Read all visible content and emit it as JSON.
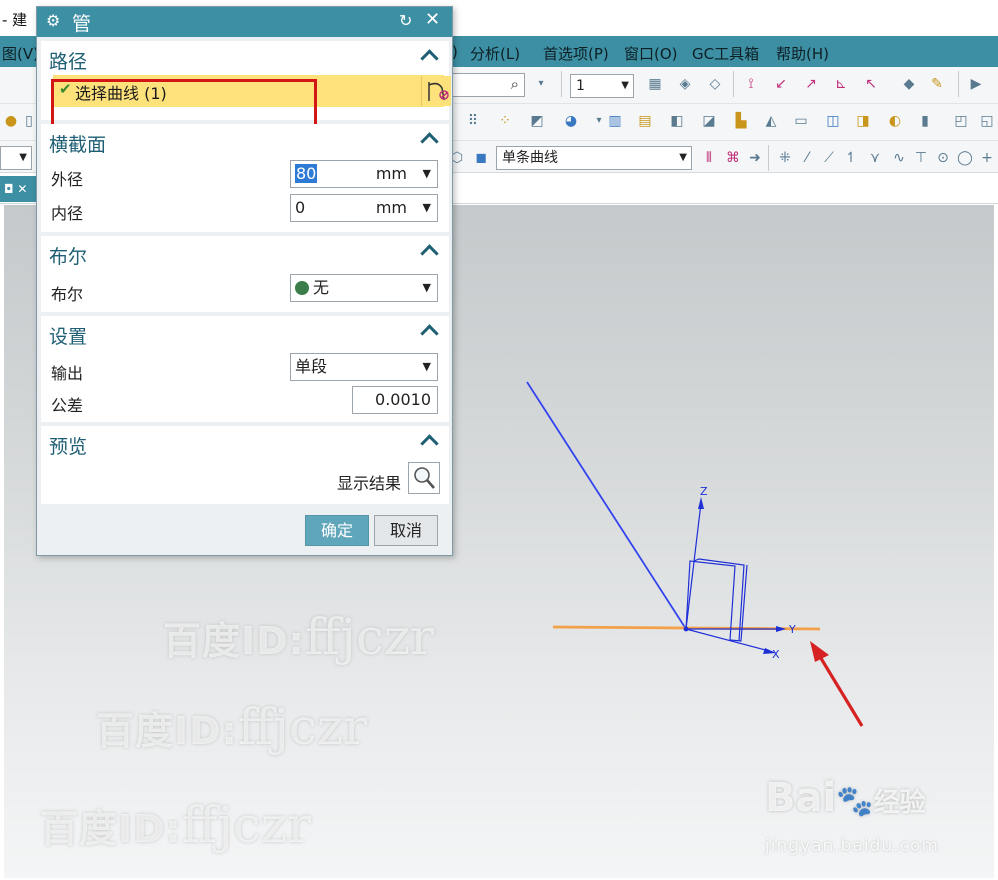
{
  "app": {
    "title_fragment": "- 建",
    "menu": [
      "图(V)",
      ")",
      "分析(L)",
      "首选项(P)",
      "窗口(O)",
      "GC工具箱",
      "帮助(H)"
    ]
  },
  "toolbar": {
    "layer_select": "1",
    "curve_rule_select": "单条曲线"
  },
  "dialog": {
    "title": "管",
    "sections": {
      "path": {
        "title": "路径",
        "select_curve_label": "选择曲线 (1)"
      },
      "cross_section": {
        "title": "横截面",
        "outer_label": "外径",
        "outer_value": "80",
        "outer_unit": "mm",
        "inner_label": "内径",
        "inner_value": "0",
        "inner_unit": "mm"
      },
      "boolean": {
        "title": "布尔",
        "label": "布尔",
        "value": "无"
      },
      "settings": {
        "title": "设置",
        "output_label": "输出",
        "output_value": "单段",
        "tolerance_label": "公差",
        "tolerance_value": "0.0010"
      },
      "preview": {
        "title": "预览",
        "show_result_label": "显示结果"
      }
    },
    "ok_label": "确定",
    "cancel_label": "取消"
  },
  "viewport": {
    "axis_labels": {
      "z": "Z",
      "y": "Y",
      "x": "X"
    },
    "colors": {
      "path_line": "#3344ee",
      "selected_line": "#f2a04a",
      "arrow": "#d62222",
      "triad": "#1f2fd8"
    }
  },
  "watermark": {
    "prefix": "百度ID:",
    "user": "ffjczr",
    "baidu_brand": "Bai",
    "baidu_brand_tail": "经验",
    "baidu_url": "jingyan.baidu.com"
  }
}
